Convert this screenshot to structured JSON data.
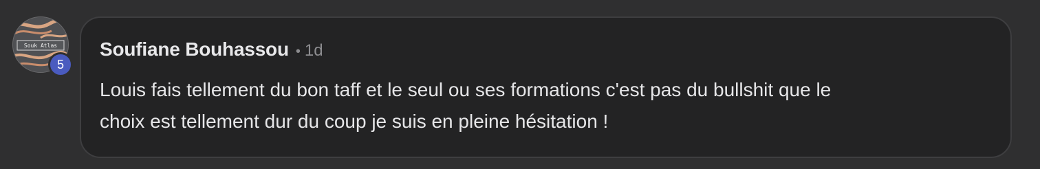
{
  "comment": {
    "avatar": {
      "icon": "souk-atlas-logo",
      "brand_text": "Souk Atlas",
      "level_badge": "5"
    },
    "author": "Soufiane Bouhassou",
    "separator": "•",
    "time": "1d",
    "text": "Louis fais tellement du bon taff et le seul ou ses formations c'est pas du bullshit que le\nchoix est tellement dur du coup je suis en pleine hésitation !"
  },
  "colors": {
    "background": "#2f2f30",
    "bubble": "#232324",
    "badge": "#4a5bbf"
  }
}
